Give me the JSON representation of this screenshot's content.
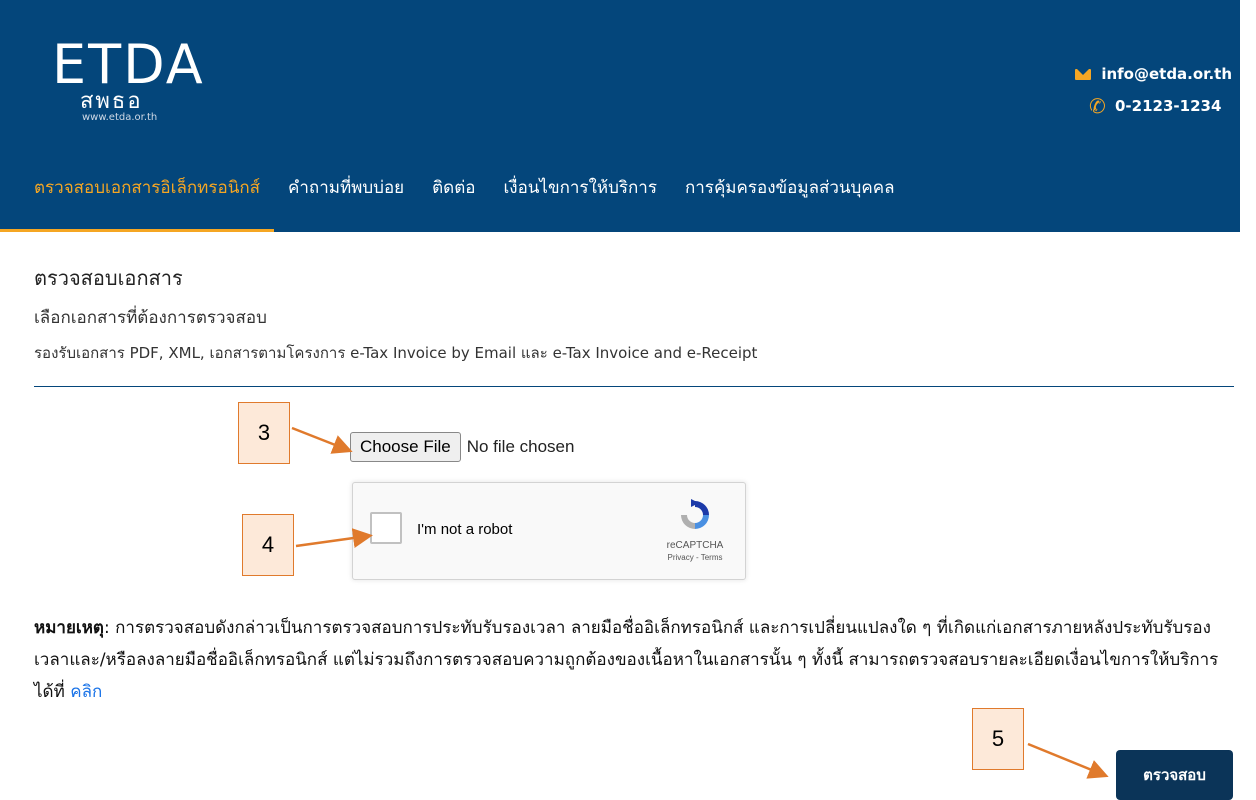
{
  "header": {
    "logo_text": "ETDA",
    "logo_sub": "สพธอ",
    "logo_url": "www.etda.or.th",
    "email": "info@etda.or.th",
    "phone": "0-2123-1234"
  },
  "nav": {
    "items": [
      {
        "label": "ตรวจสอบเอกสารอิเล็กทรอนิกส์",
        "active": true
      },
      {
        "label": "คำถามที่พบบ่อย",
        "active": false
      },
      {
        "label": "ติดต่อ",
        "active": false
      },
      {
        "label": "เงื่อนไขการให้บริการ",
        "active": false
      },
      {
        "label": "การคุ้มครองข้อมูลส่วนบุคคล",
        "active": false
      }
    ]
  },
  "main": {
    "title": "ตรวจสอบเอกสาร",
    "subtitle": "เลือกเอกสารที่ต้องการตรวจสอบ",
    "description": "รองรับเอกสาร PDF, XML, เอกสารตามโครงการ e-Tax Invoice by Email และ e-Tax Invoice and e-Receipt",
    "file_button": "Choose File",
    "file_status": "No file chosen",
    "recaptcha": {
      "label": "I'm not a robot",
      "brand": "reCAPTCHA",
      "links": "Privacy - Terms"
    },
    "note_label": "หมายเหตุ",
    "note_text": ": การตรวจสอบดังกล่าวเป็นการตรวจสอบการประทับรับรองเวลา ลายมือชื่ออิเล็กทรอนิกส์ และการเปลี่ยนแปลงใด ๆ ที่เกิดแก่เอกสารภายหลังประทับรับรองเวลาและ/หรือลงลายมือชื่ออิเล็กทรอนิกส์ แต่ไม่รวมถึงการตรวจสอบความถูกต้องของเนื้อหาในเอกสารนั้น ๆ ทั้งนี้ สามารถตรวจสอบรายละเอียดเงื่อนไขการให้บริการได้ที่ ",
    "note_link": "คลิก",
    "submit_label": "ตรวจสอบ"
  },
  "callouts": {
    "c3": "3",
    "c4": "4",
    "c5": "5"
  },
  "colors": {
    "header_bg": "#04467b",
    "accent": "#f5a623",
    "submit_bg": "#0b3458",
    "callout_border": "#e07a2c",
    "callout_fill": "#fde9d9"
  }
}
